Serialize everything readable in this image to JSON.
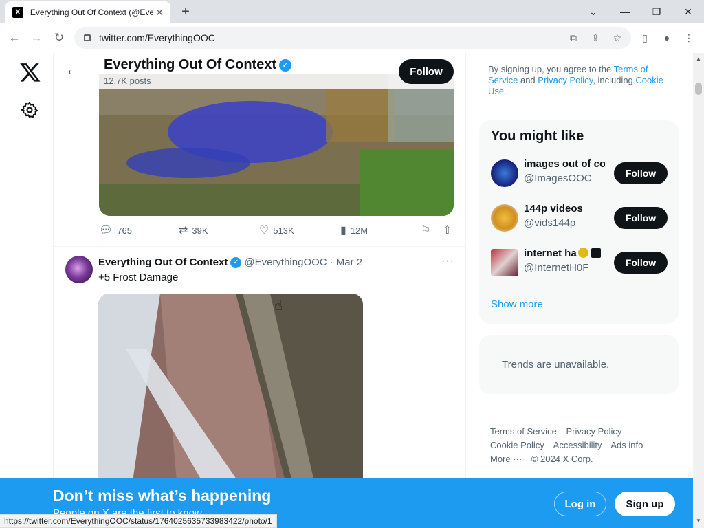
{
  "browser": {
    "tab_title": "Everything Out Of Context (@Eve",
    "favicon": "X",
    "url": "twitter.com/EverythingOOC",
    "status_url": "https://twitter.com/EverythingOOC/status/1764025635733983422/photo/1"
  },
  "header": {
    "name": "Everything Out Of Context",
    "posts": "12.7K posts",
    "follow_label": "Follow"
  },
  "tweet1": {
    "replies": "765",
    "retweets": "39K",
    "likes": "513K",
    "views": "12M"
  },
  "tweet2": {
    "name": "Everything Out Of Context",
    "handle": "@EverythingOOC",
    "date": "· Mar 2",
    "text": "+5 Frost Damage"
  },
  "right": {
    "signup_note": {
      "prefix": "By signing up, you agree to the ",
      "tos": "Terms of Service",
      "and": " and ",
      "privacy": "Privacy Policy",
      "including": ", including ",
      "cookie": "Cookie Use",
      "end": "."
    },
    "you_might_like": {
      "title": "You might like",
      "items": [
        {
          "name": "images out of co",
          "handle": "@ImagesOOC",
          "follow": "Follow"
        },
        {
          "name": "144p videos",
          "handle": "@vids144p",
          "follow": "Follow"
        },
        {
          "name": "internet ha",
          "handle": "@InternetH0F",
          "follow": "Follow"
        }
      ],
      "show_more": "Show more"
    },
    "trends": "Trends are unavailable.",
    "footer": [
      "Terms of Service",
      "Privacy Policy",
      "Cookie Policy",
      "Accessibility",
      "Ads info",
      "More ···",
      "© 2024 X Corp."
    ]
  },
  "banner": {
    "headline": "Don’t miss what’s happening",
    "sub": "People on X are the first to know.",
    "login": "Log in",
    "signup": "Sign up"
  },
  "colors": {
    "accent": "#1d9bf0",
    "dark": "#0f1419",
    "muted": "#536471"
  }
}
